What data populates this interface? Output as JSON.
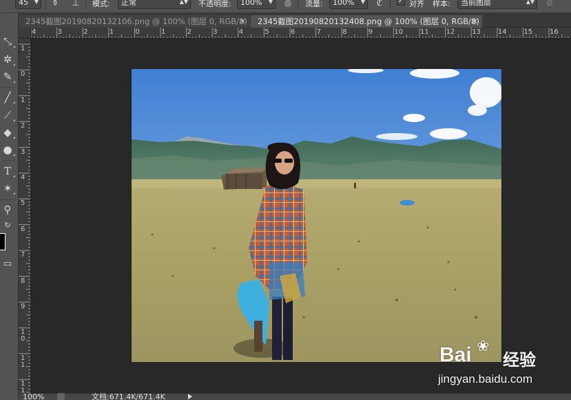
{
  "options_bar": {
    "brush_size": "45",
    "mode_label": "模式:",
    "mode_value": "正常",
    "opacity_label": "不透明度:",
    "opacity_value": "100%",
    "flow_label": "流量:",
    "flow_value": "100%",
    "align_label": "对齐",
    "align_checked": true,
    "sample_label": "样本:",
    "sample_value": "当前图层"
  },
  "tabs": [
    {
      "label": "2345截图20190820132106.png @ 100% (图层 0, RGB/8)",
      "close": "×",
      "active": false
    },
    {
      "label": "2345截图20190820132408.png @ 100% (图层 0, RGB/8)",
      "close": "×",
      "active": true
    }
  ],
  "ruler_h": [
    "4",
    "3",
    "2",
    "1",
    "0",
    "1",
    "2",
    "3",
    "4",
    "5",
    "6",
    "7",
    "8",
    "9",
    "10",
    "11",
    "12",
    "13",
    "14",
    "15",
    "16"
  ],
  "ruler_v": [
    "1",
    "0",
    "1",
    "2",
    "3",
    "4",
    "5",
    "6",
    "7",
    "8",
    "9",
    "1\n0",
    "1\n1",
    "1\n1"
  ],
  "tools": [
    "move-tool",
    "magic-wand-tool",
    "eyedropper-tool",
    "brush-tool",
    "history-brush-tool",
    "paint-bucket-tool",
    "dodge-tool",
    "type-tool",
    "custom-shape-tool",
    "zoom-tool",
    "swap-colors",
    "screen-mode"
  ],
  "type_tool_glyph": "T",
  "status": {
    "zoom": "100%",
    "doc_info": "文档:671.4K/671.4K"
  },
  "watermark": {
    "brand": "Bai",
    "brand_tail": "经验",
    "url": "jingyan.baidu.com"
  },
  "colors": {
    "panel": "#535353",
    "canvas_bg": "#282828",
    "foreground": "#000000",
    "sky": "#5b8fd6",
    "grass": "#a8a266"
  }
}
